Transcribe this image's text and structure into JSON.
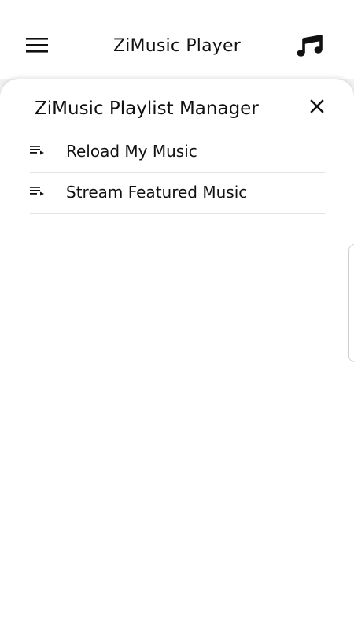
{
  "app_bar": {
    "title": "ZiMusic Player",
    "menu_icon": "hamburger-menu-icon",
    "music_icon": "music-notes-icon"
  },
  "sheet": {
    "title": "ZiMusic Playlist Manager",
    "close_icon": "close-icon",
    "items": [
      {
        "label": "Reload My Music",
        "icon": "playlist-play-icon"
      },
      {
        "label": "Stream Featured Music",
        "icon": "playlist-play-icon"
      }
    ]
  }
}
